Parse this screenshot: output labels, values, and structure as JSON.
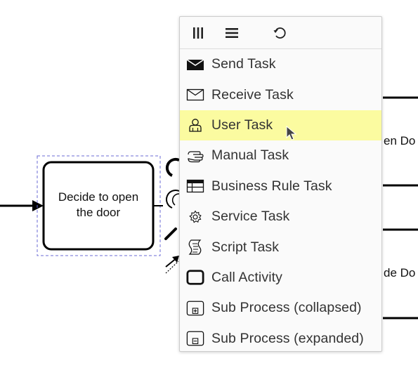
{
  "diagram": {
    "task_label_line1": "Decide to open",
    "task_label_line2": "the door",
    "partial_label_1": "en Do",
    "partial_label_2": "de Do"
  },
  "popup": {
    "header_buttons": [
      {
        "icon": "columns-icon"
      },
      {
        "icon": "list-icon"
      },
      {
        "icon": "loop-icon"
      }
    ],
    "entries": [
      {
        "label": "Send Task",
        "icon": "send-task-icon",
        "active": false
      },
      {
        "label": "Receive Task",
        "icon": "receive-task-icon",
        "active": false
      },
      {
        "label": "User Task",
        "icon": "user-task-icon",
        "active": true
      },
      {
        "label": "Manual Task",
        "icon": "manual-task-icon",
        "active": false
      },
      {
        "label": "Business Rule Task",
        "icon": "business-rule-task-icon",
        "active": false
      },
      {
        "label": "Service Task",
        "icon": "service-task-icon",
        "active": false
      },
      {
        "label": "Script Task",
        "icon": "script-task-icon",
        "active": false
      },
      {
        "label": "Call Activity",
        "icon": "call-activity-icon",
        "active": false
      },
      {
        "label": "Sub Process (collapsed)",
        "icon": "subprocess-collapsed-icon",
        "active": false
      },
      {
        "label": "Sub Process (expanded)",
        "icon": "subprocess-expanded-icon",
        "active": false
      }
    ],
    "active_color": "#fbfba0"
  }
}
